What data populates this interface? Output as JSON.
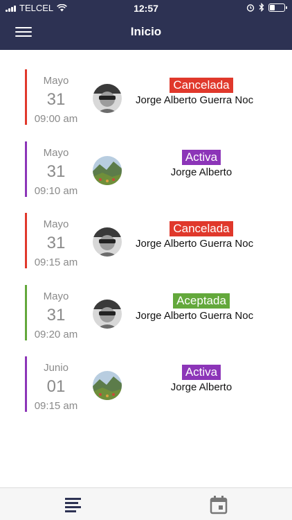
{
  "status": {
    "carrier": "TELCEL",
    "time": "12:57",
    "battery_level": 0.3
  },
  "header": {
    "title": "Inicio",
    "menu_icon": "hamburger-menu-icon"
  },
  "colors": {
    "header_bg": "#2d3253",
    "cancelada": "#e0382b",
    "activa": "#8c35b8",
    "aceptada": "#63a83b"
  },
  "appointments": [
    {
      "month": "Mayo",
      "day": "31",
      "time": "09:00 am",
      "status": "Cancelada",
      "status_color": "#e0382b",
      "name": "Jorge Alberto Guerra Noc",
      "avatar": "person-photo"
    },
    {
      "month": "Mayo",
      "day": "31",
      "time": "09:10 am",
      "status": "Activa",
      "status_color": "#8c35b8",
      "name": "Jorge Alberto",
      "avatar": "landscape-photo"
    },
    {
      "month": "Mayo",
      "day": "31",
      "time": "09:15 am",
      "status": "Cancelada",
      "status_color": "#e0382b",
      "name": "Jorge Alberto Guerra Noc",
      "avatar": "person-photo"
    },
    {
      "month": "Mayo",
      "day": "31",
      "time": "09:20 am",
      "status": "Aceptada",
      "status_color": "#63a83b",
      "name": "Jorge Alberto Guerra Noc",
      "avatar": "person-photo"
    },
    {
      "month": "Junio",
      "day": "01",
      "time": "09:15 am",
      "status": "Activa",
      "status_color": "#8c35b8",
      "name": "Jorge Alberto",
      "avatar": "landscape-photo"
    }
  ],
  "tabbar": {
    "tabs": [
      {
        "icon": "list-icon"
      },
      {
        "icon": "calendar-icon"
      }
    ]
  }
}
